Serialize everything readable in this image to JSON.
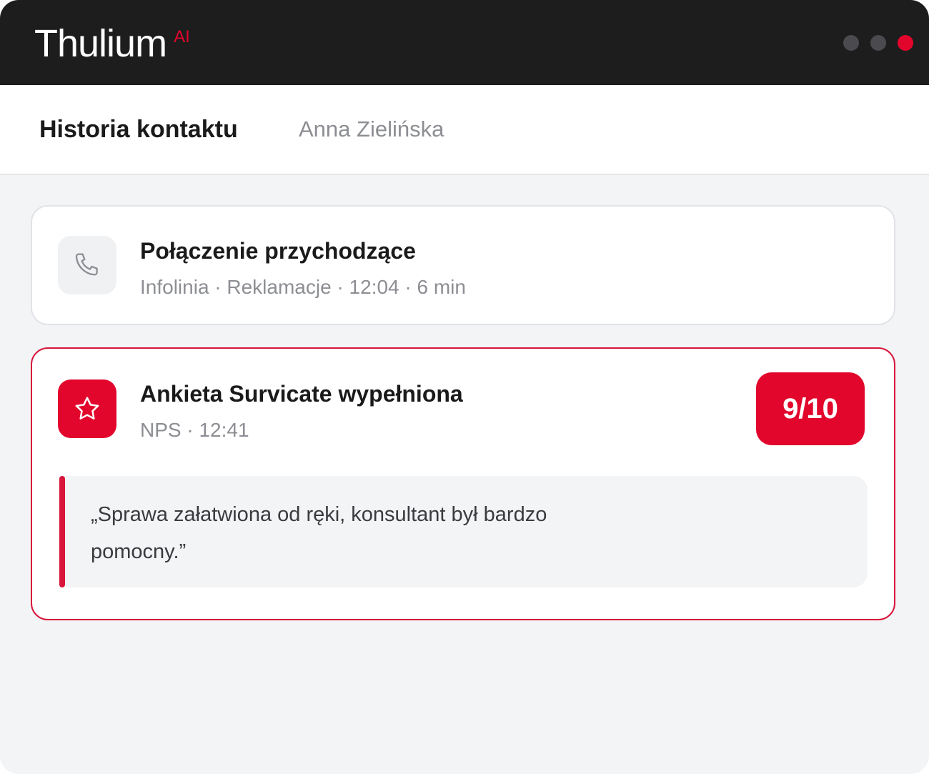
{
  "app": {
    "brand": "Thulium",
    "brand_suffix": "AI",
    "window_dots": [
      "#4b4b4f",
      "#4b4b4f",
      "#e2062c"
    ]
  },
  "header": {
    "title": "Historia kontaktu",
    "contact_name": "Anna Zielińska"
  },
  "timeline": {
    "items": [
      {
        "icon": "phone-icon",
        "title": "Połączenie przychodzące",
        "meta": "Infolinia · Reklamacje · 12:04 · 6 min"
      },
      {
        "icon": "star-icon",
        "title": "Ankieta Survicate wypełniona",
        "meta": "NPS · 12:41",
        "score": "9/10",
        "quote": "„Sprawa załatwiona od ręki, konsultant był bardzo pomocny.”"
      }
    ]
  },
  "colors": {
    "accent": "#e2062c",
    "titlebar": "#1d1d1d",
    "background": "#f3f4f6",
    "muted_text": "#8c8e93"
  }
}
